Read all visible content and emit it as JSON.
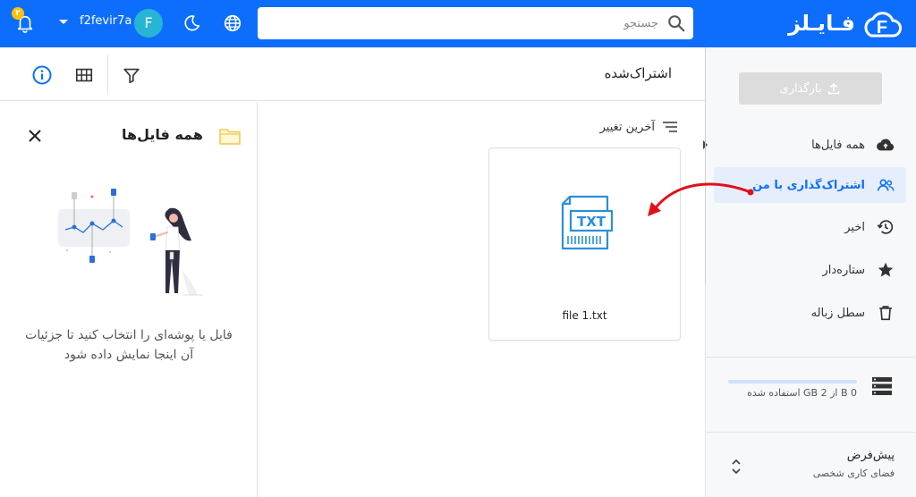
{
  "brand": {
    "name": "فـایـلز",
    "logo_letter": "F"
  },
  "search": {
    "placeholder": "جستجو"
  },
  "user": {
    "name": "f2fevir7a",
    "avatar_letter": "F"
  },
  "notifications": {
    "count": "۲"
  },
  "sidebar": {
    "upload_label": "بارگذاری",
    "items": [
      {
        "label": "همه فایل‌ها",
        "icon": "cloud-upload-icon",
        "active": false
      },
      {
        "label": "اشتراک‌گذاری با من",
        "icon": "people-icon",
        "active": true
      },
      {
        "label": "اخیر",
        "icon": "history-icon",
        "active": false
      },
      {
        "label": "ستاره‌دار",
        "icon": "star-icon",
        "active": false
      },
      {
        "label": "سطل زباله",
        "icon": "trash-icon",
        "active": false
      }
    ],
    "storage": {
      "text": "0 B از 2 GB استفاده شده",
      "used_fraction": 0
    },
    "workspace": {
      "title": "پیش‌فرض",
      "subtitle": "فضای کاری شخصی"
    }
  },
  "main": {
    "title": "اشتراک‌شده",
    "sort_label": "آخرین تغییر",
    "files": [
      {
        "name": "file 1.txt",
        "type": "TXT"
      }
    ]
  },
  "details": {
    "title": "همه فایل‌ها",
    "message": "فایل یا پوشه‌ای را انتخاب کنید تا جزئیات آن اینجا نمایش داده شود"
  },
  "colors": {
    "primary": "#0d6efd",
    "accent_red": "#e0101a",
    "file_icon": "#2b8fd9"
  }
}
